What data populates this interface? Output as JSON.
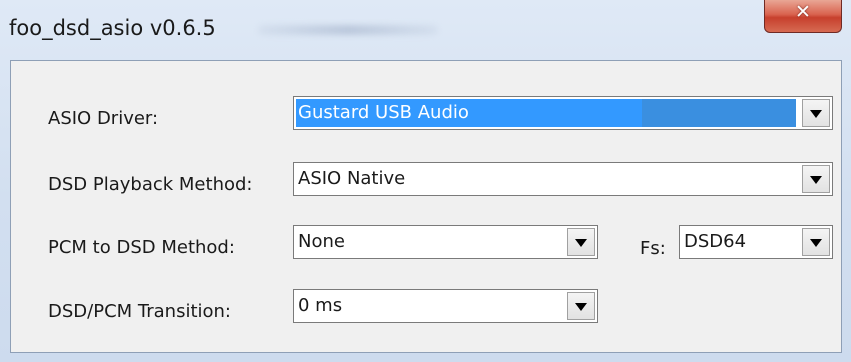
{
  "window": {
    "title": "foo_dsd_asio v0.6.5",
    "close_icon": "close-icon",
    "close_glyph": "✕"
  },
  "form": {
    "asio_driver": {
      "label": "ASIO Driver:",
      "value": "Gustard USB Audio"
    },
    "dsd_playback_method": {
      "label": "DSD Playback Method:",
      "value": "ASIO Native"
    },
    "pcm_to_dsd_method": {
      "label": "PCM to DSD Method:",
      "value": "None"
    },
    "fs": {
      "label": "Fs:",
      "value": "DSD64"
    },
    "dsd_pcm_transition": {
      "label": "DSD/PCM Transition:",
      "value": "0 ms"
    }
  },
  "icons": {
    "dropdown": "chevron-down-icon",
    "close": "close-icon"
  },
  "colors": {
    "selection": "#3399ff",
    "close_button": "#c7402d"
  }
}
